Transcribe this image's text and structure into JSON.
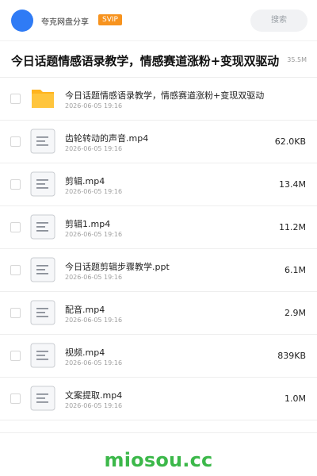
{
  "header": {
    "brand": "夸克网盘分享",
    "badge": "SVIP",
    "search_label": "搜索"
  },
  "folder": {
    "title": "今日话题情感语录教学，情感赛道涨粉+变现双驱动",
    "size": "35.5M"
  },
  "files": [
    {
      "name": "今日话题情感语录教学，情感赛道涨粉+变现双驱动",
      "date": "2026-06-05 19:16",
      "size": "",
      "icon": "folder-icon"
    },
    {
      "name": "齿轮转动的声音.mp4",
      "date": "2026-06-05 19:16",
      "size": "62.0KB",
      "icon": "file-icon"
    },
    {
      "name": "剪辑.mp4",
      "date": "2026-06-05 19:16",
      "size": "13.4M",
      "icon": "file-icon"
    },
    {
      "name": "剪辑1.mp4",
      "date": "2026-06-05 19:16",
      "size": "11.2M",
      "icon": "file-icon"
    },
    {
      "name": "今日话题剪辑步骤教学.ppt",
      "date": "2026-06-05 19:16",
      "size": "6.1M",
      "icon": "file-icon"
    },
    {
      "name": "配音.mp4",
      "date": "2026-06-05 19:16",
      "size": "2.9M",
      "icon": "file-icon"
    },
    {
      "name": "视频.mp4",
      "date": "2026-06-05 19:16",
      "size": "839KB",
      "icon": "file-icon"
    },
    {
      "name": "文案提取.mp4",
      "date": "2026-06-05 19:16",
      "size": "1.0M",
      "icon": "file-icon"
    }
  ],
  "watermark": "miosou.cc",
  "colors": {
    "brand_blue": "#2f7bf5",
    "svip_orange": "#f7931e",
    "folder_yellow": "#ffc53d",
    "watermark_green": "#3cb84a"
  }
}
